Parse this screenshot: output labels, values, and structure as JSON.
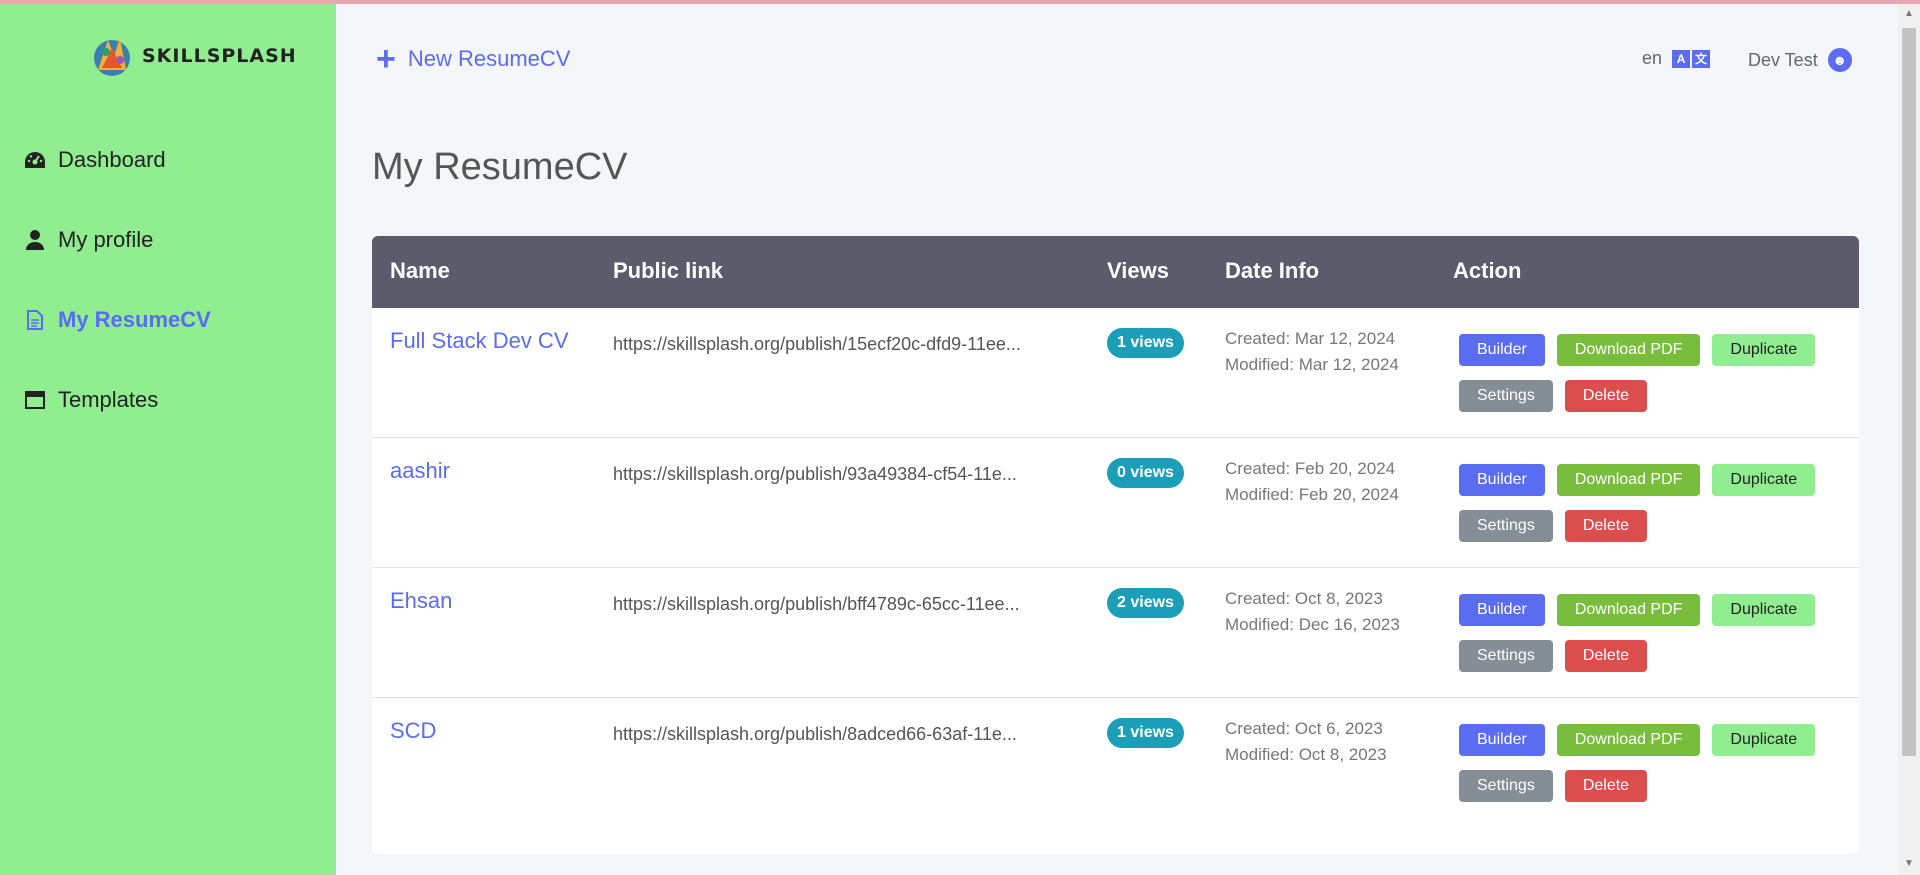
{
  "brand": {
    "name": "SKILLSPLASH"
  },
  "sidebar": {
    "items": [
      {
        "label": "Dashboard",
        "icon": "dashboard-icon"
      },
      {
        "label": "My profile",
        "icon": "user-icon"
      },
      {
        "label": "My ResumeCV",
        "icon": "document-icon",
        "active": true
      },
      {
        "label": "Templates",
        "icon": "window-icon"
      }
    ]
  },
  "header": {
    "new_button": "New ResumeCV",
    "language": "en",
    "user_name": "Dev Test"
  },
  "page": {
    "title": "My ResumeCV"
  },
  "table": {
    "headers": {
      "name": "Name",
      "link": "Public link",
      "views": "Views",
      "date": "Date Info",
      "action": "Action"
    },
    "rows": [
      {
        "name": "Full Stack Dev CV",
        "link": "https://skillsplash.org/publish/15ecf20c-dfd9-11ee...",
        "views": "1 views",
        "created": "Created: Mar 12, 2024",
        "modified": "Modified: Mar 12, 2024"
      },
      {
        "name": "aashir",
        "link": "https://skillsplash.org/publish/93a49384-cf54-11e...",
        "views": "0 views",
        "created": "Created: Feb 20, 2024",
        "modified": "Modified: Feb 20, 2024"
      },
      {
        "name": "Ehsan",
        "link": "https://skillsplash.org/publish/bff4789c-65cc-11ee...",
        "views": "2 views",
        "created": "Created: Oct 8, 2023",
        "modified": "Modified: Dec 16, 2023"
      },
      {
        "name": "SCD",
        "link": "https://skillsplash.org/publish/8adced66-63af-11e...",
        "views": "1 views",
        "created": "Created: Oct 6, 2023",
        "modified": "Modified: Oct 8, 2023"
      }
    ],
    "actions": {
      "builder": "Builder",
      "pdf": "Download PDF",
      "duplicate": "Duplicate",
      "settings": "Settings",
      "delete": "Delete"
    }
  },
  "colors": {
    "sidebar": "#90ee90",
    "accent": "#5a6cf0",
    "header_bg": "#5a5c6b",
    "views_badge": "#1b9fb8"
  }
}
